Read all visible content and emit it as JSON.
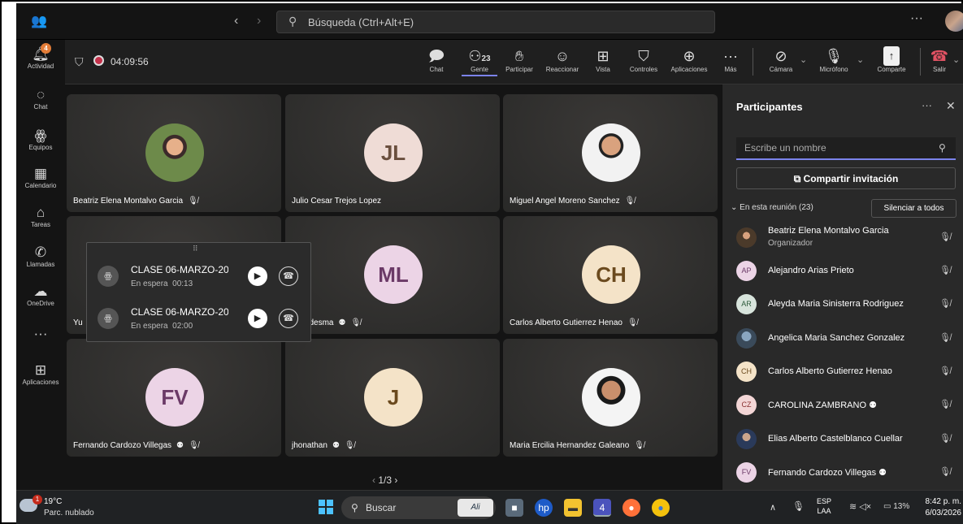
{
  "titlebar": {
    "search_placeholder": "Búsqueda (Ctrl+Alt+E)",
    "more": "···"
  },
  "rail": [
    {
      "label": "Actividad",
      "icon": "bell-icon",
      "badge": "4"
    },
    {
      "label": "Chat",
      "icon": "chat-icon"
    },
    {
      "label": "Equipos",
      "icon": "teams-icon"
    },
    {
      "label": "Calendario",
      "icon": "calendar-icon"
    },
    {
      "label": "Tareas",
      "icon": "tasks-icon"
    },
    {
      "label": "Llamadas",
      "icon": "phone-icon"
    },
    {
      "label": "OneDrive",
      "icon": "cloud-icon"
    },
    {
      "label": "···",
      "icon": "more-icon"
    },
    {
      "label": "Aplicaciones",
      "icon": "apps-icon"
    }
  ],
  "meeting": {
    "timer": "04:09:56",
    "tools": {
      "chat": "Chat",
      "people": "Gente",
      "people_count": "23",
      "raise": "Participar",
      "react": "Reaccionar",
      "view": "Vista",
      "controls": "Controles",
      "apps": "Aplicaciones",
      "more": "Más",
      "camera": "Cámara",
      "mic": "Micrófono",
      "share": "Comparte",
      "leave": "Salir"
    }
  },
  "tiles": [
    {
      "name": "Beatriz Elena Montalvo Garcia",
      "initials": ""
    },
    {
      "name": "Julio Cesar Trejos Lopez",
      "initials": "JL"
    },
    {
      "name": "Miguel Angel Moreno Sanchez",
      "initials": ""
    },
    {
      "name": "Yu",
      "initials": ""
    },
    {
      "name": "nael ledesma",
      "initials": "ML"
    },
    {
      "name": "Carlos Alberto Gutierrez Henao",
      "initials": "CH"
    },
    {
      "name": "Fernando Cardozo Villegas",
      "initials": "FV"
    },
    {
      "name": "jhonathan",
      "initials": "J"
    },
    {
      "name": "Maria Ercilia Hernandez Galeano",
      "initials": ""
    }
  ],
  "pager": {
    "text": "1/3"
  },
  "calls": [
    {
      "title": "CLASE 06-MARZO-2026",
      "status": "En espera",
      "time": "00:13"
    },
    {
      "title": "CLASE 06-MARZO-2026",
      "status": "En espera",
      "time": "02:00"
    }
  ],
  "panel": {
    "title": "Participantes",
    "search_placeholder": "Escribe un nombre",
    "invite": "Compartir invitación",
    "in_meeting": "En esta reunión (23)",
    "mute_all": "Silenciar a todos",
    "participants": [
      {
        "name": "Beatriz Elena Montalvo Garcia",
        "role": "Organizador",
        "initials": ""
      },
      {
        "name": "Alejandro Arias Prieto",
        "initials": "AP"
      },
      {
        "name": "Aleyda Maria Sinisterra Rodriguez",
        "initials": "AR"
      },
      {
        "name": "Angelica Maria Sanchez Gonzalez",
        "initials": ""
      },
      {
        "name": "Carlos Alberto Gutierrez Henao",
        "initials": "CH"
      },
      {
        "name": "CAROLINA ZAMBRANO",
        "initials": "CZ"
      },
      {
        "name": "Elias Alberto Castelblanco Cuellar",
        "initials": ""
      },
      {
        "name": "Fernando Cardozo Villegas",
        "initials": "FV"
      }
    ]
  },
  "taskbar": {
    "weather_badge": "1",
    "temp": "19°C",
    "weather": "Parc. nublado",
    "search": "Buscar",
    "teams_badge": "4",
    "lang1": "ESP",
    "lang2": "LAA",
    "battery": "13%",
    "time": "8:42 p. m.",
    "date": "6/03/2026"
  }
}
